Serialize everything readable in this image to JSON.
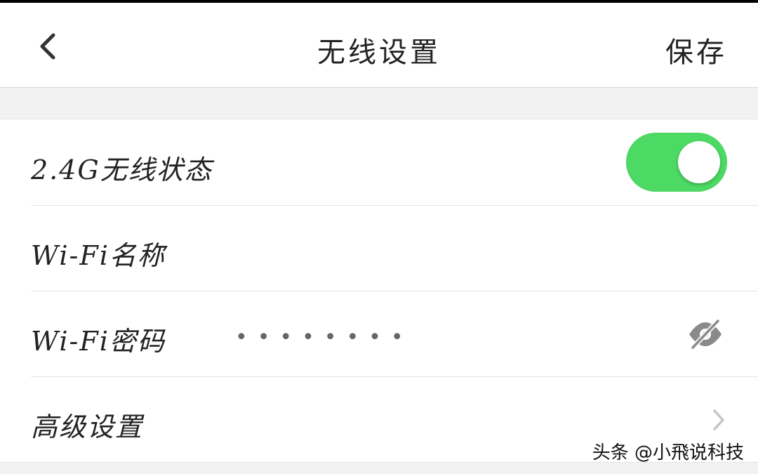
{
  "header": {
    "back_icon": "chevron-left-icon",
    "title": "无线设置",
    "save_label": "保存"
  },
  "settings": {
    "wireless_status": {
      "label": "2.4G无线状态",
      "enabled": true,
      "toggle_color": "#4cd964"
    },
    "wifi_name": {
      "label": "Wi-Fi名称",
      "value": ""
    },
    "wifi_password": {
      "label": "Wi-Fi密码",
      "masked_value": "••••••••",
      "visibility_icon": "eye-slash-icon"
    },
    "advanced": {
      "label": "高级设置",
      "chevron_icon": "chevron-right-icon"
    }
  },
  "watermark": {
    "text": "头条 @小飛说科技"
  }
}
